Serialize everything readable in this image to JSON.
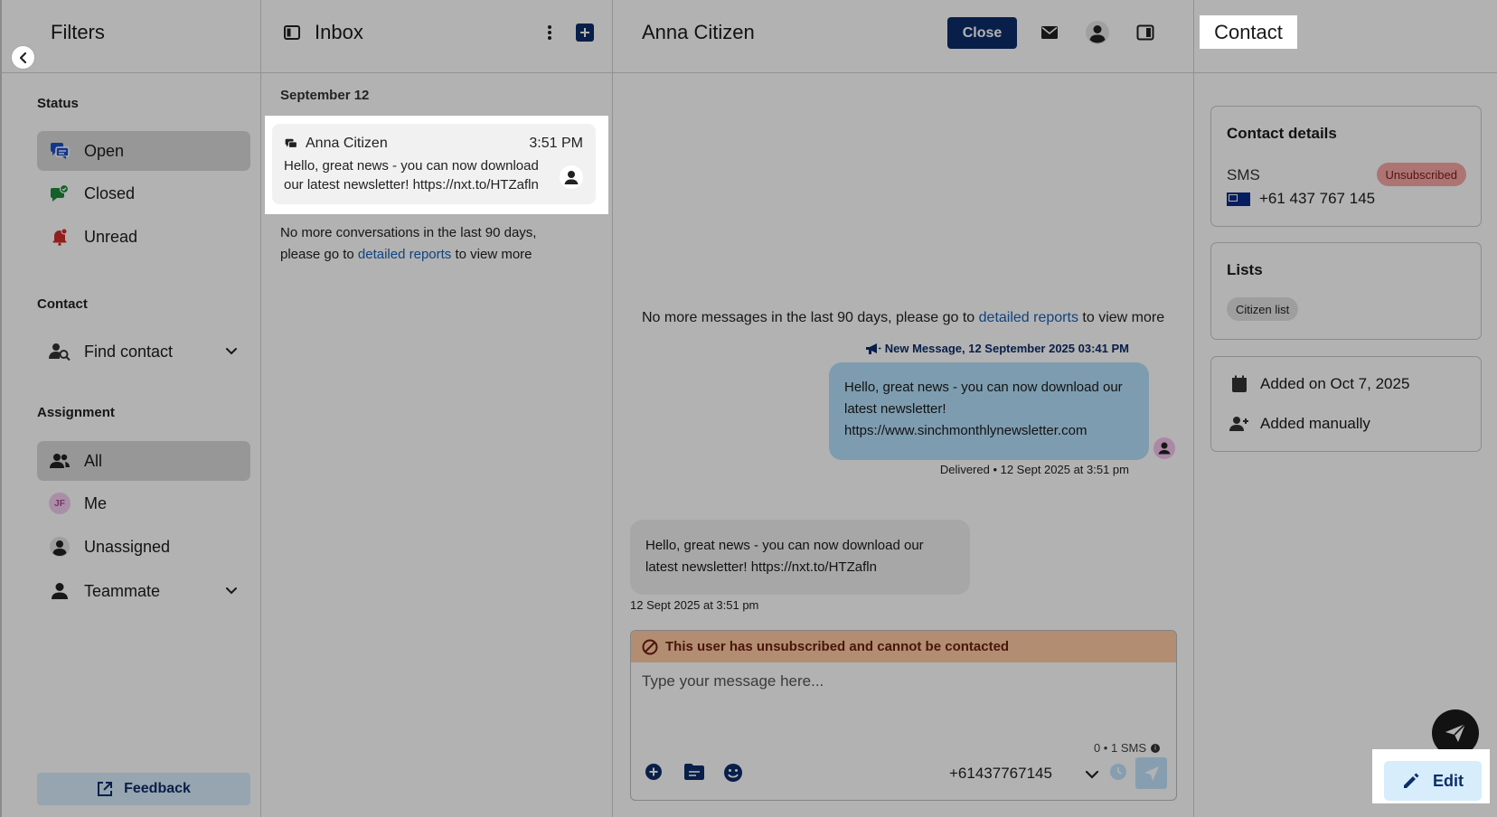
{
  "filters": {
    "title": "Filters",
    "status_label": "Status",
    "status_items": [
      {
        "label": "Open",
        "icon": "chat-bubbles-icon"
      },
      {
        "label": "Closed",
        "icon": "chat-closed-icon"
      },
      {
        "label": "Unread",
        "icon": "bell-icon"
      }
    ],
    "contact_label": "Contact",
    "find_contact": "Find contact",
    "assignment_label": "Assignment",
    "assignment_items": [
      {
        "label": "All"
      },
      {
        "label": "Me",
        "initials": "JF"
      },
      {
        "label": "Unassigned"
      },
      {
        "label": "Teammate"
      }
    ],
    "feedback_label": "Feedback"
  },
  "inbox": {
    "title": "Inbox",
    "date_separator": "September 12",
    "conversation": {
      "name": "Anna Citizen",
      "time": "3:51 PM",
      "preview": "Hello, great news - you can now download our latest newsletter!  https://nxt.to/HTZafln"
    },
    "no_more_prefix": "No more conversations in the last 90 days, please go to ",
    "no_more_link": "detailed reports",
    "no_more_suffix": " to view more"
  },
  "conversation": {
    "title": "Anna Citizen",
    "close_label": "Close",
    "no_more_prefix": "No more messages in the last 90 days, please go to ",
    "no_more_link": "detailed reports",
    "no_more_suffix": " to view more",
    "new_message_tag": "New Message, 12 September 2025 03:41 PM",
    "outgoing_text": "Hello, great news - you can now download our latest newsletter! https://www.sinchmonthlynewsletter.com",
    "delivered_text": "Delivered • 12 Sept 2025 at 3:51 pm",
    "incoming_text": "Hello, great news - you can now download our latest newsletter!  https://nxt.to/HTZafln",
    "incoming_time": "12 Sept 2025 at 3:51 pm",
    "unsubscribed_banner": "This user has unsubscribed and cannot be contacted",
    "composer_placeholder": "Type your message here...",
    "sms_count": "0 • 1 SMS",
    "from_number": "+61437767145"
  },
  "contact": {
    "title": "Contact",
    "details_title": "Contact details",
    "channel": "SMS",
    "status_badge": "Unsubscribed",
    "phone": "+61 437 767 145",
    "lists_title": "Lists",
    "list_chip": "Citizen list",
    "added_on": "Added on Oct 7, 2025",
    "added_how": "Added manually",
    "edit_label": "Edit"
  },
  "colors": {
    "brand_navy": "#0c2d6b",
    "outgoing_bubble": "#b4e0fb",
    "unsub_banner": "#ffcaa3",
    "unsub_badge": "#f6a8a6",
    "link": "#1661b8"
  }
}
